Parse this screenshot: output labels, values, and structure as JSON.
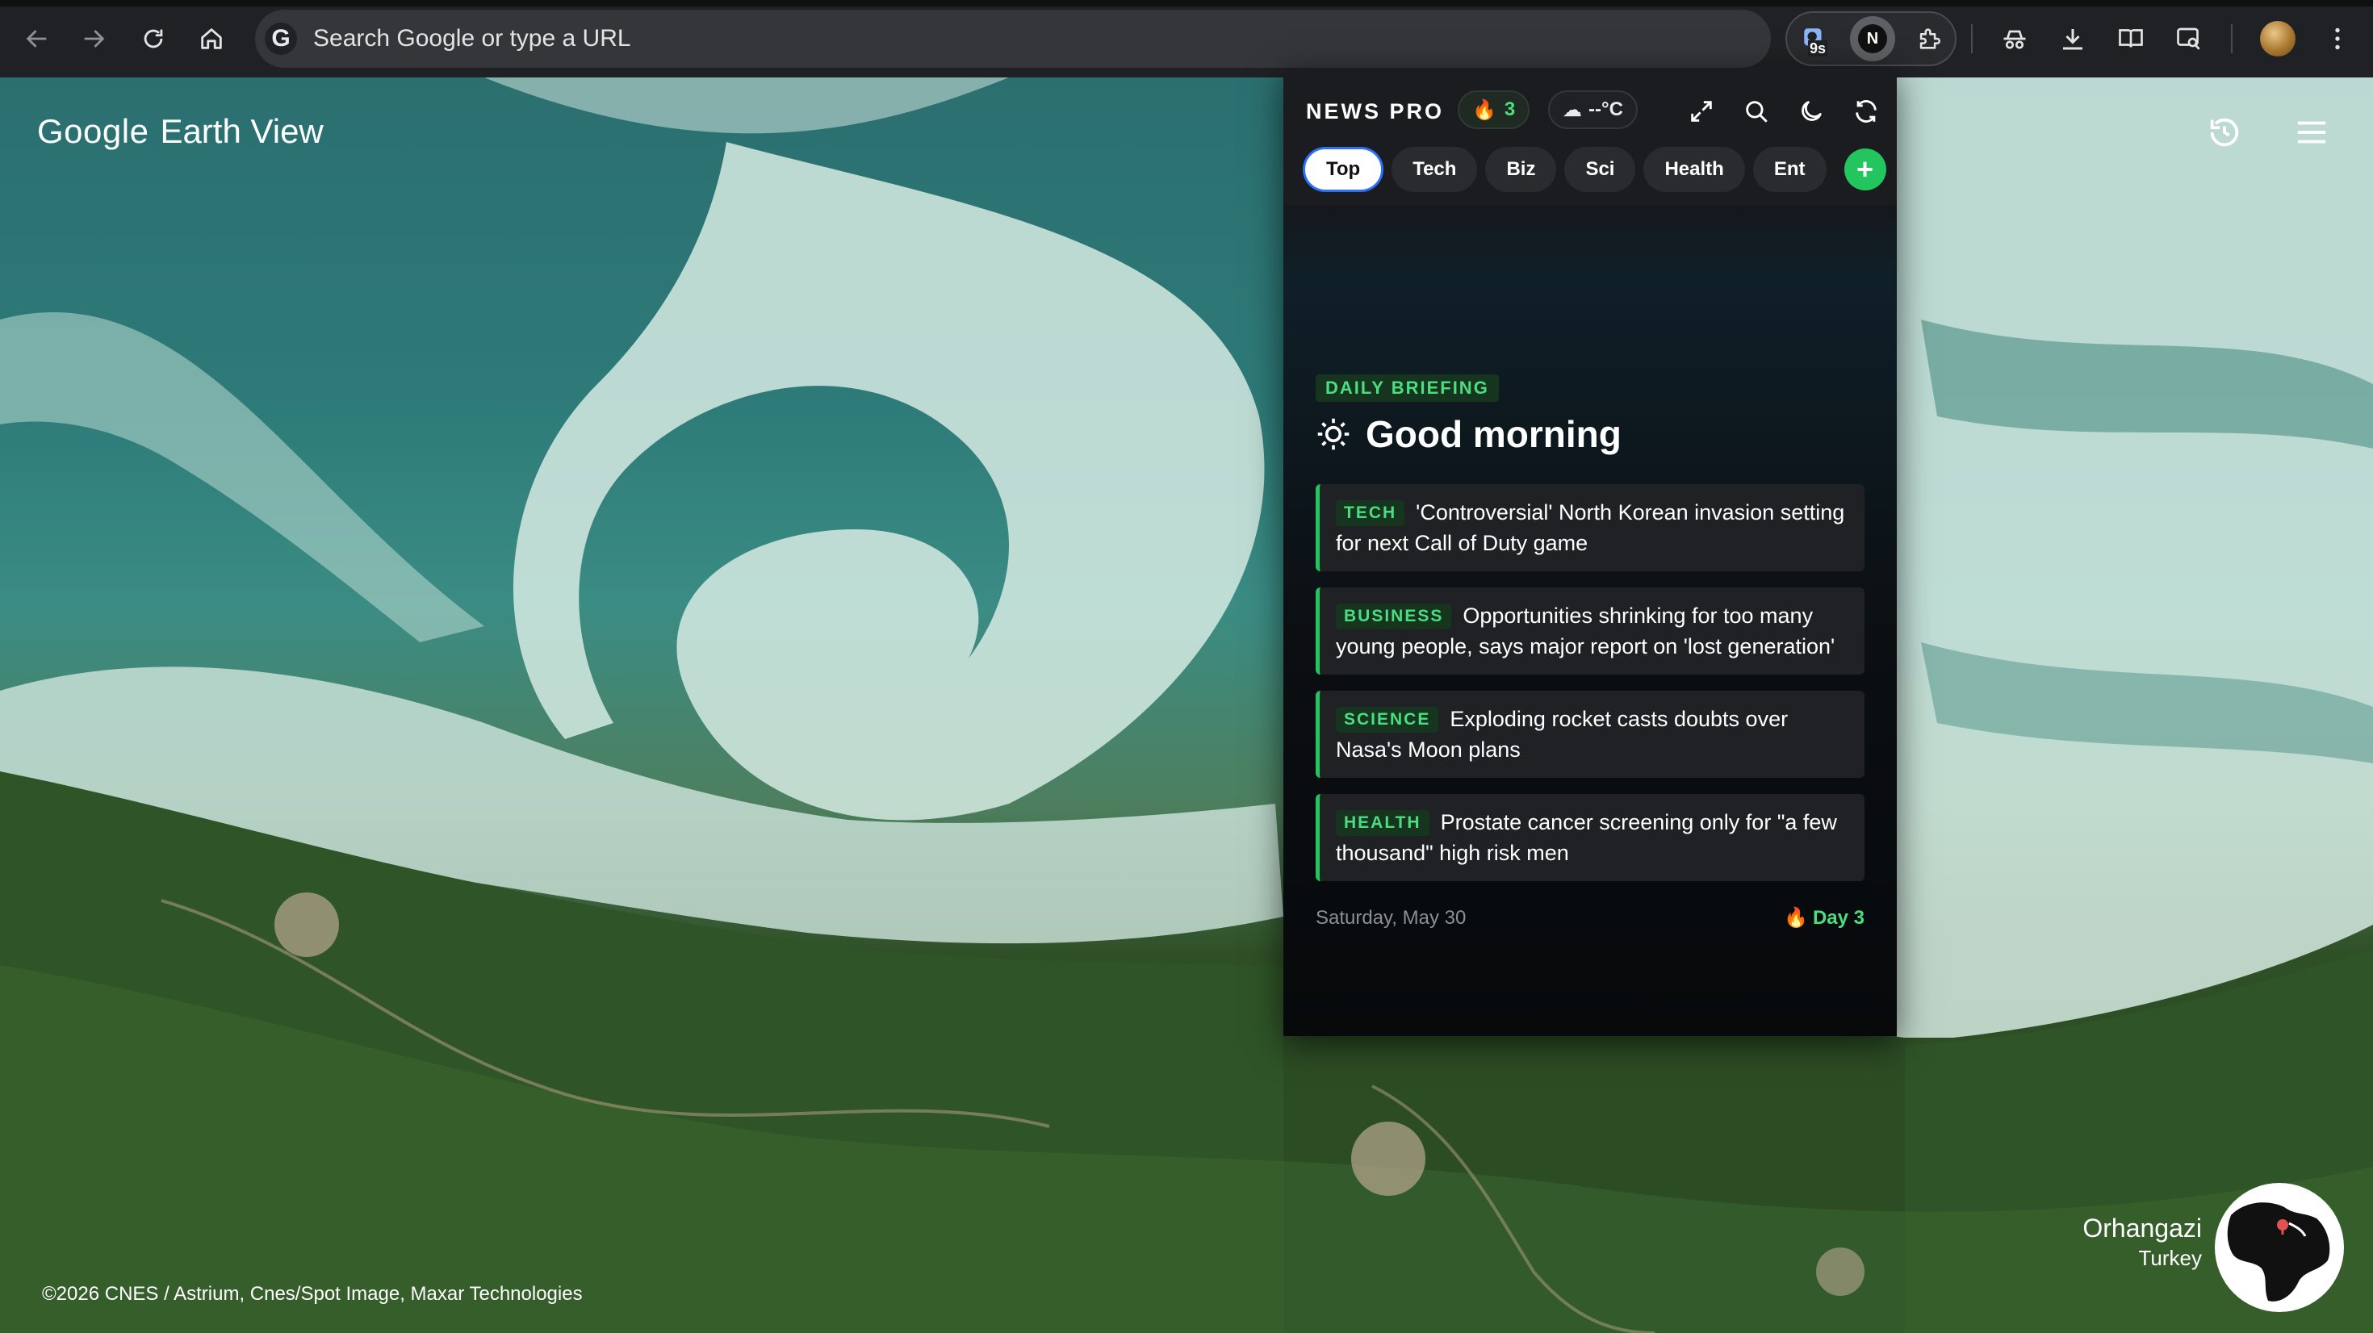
{
  "browser": {
    "omnibox_placeholder": "Search Google or type a URL",
    "google_logo_letter": "G",
    "extension_badge": "9s",
    "news_ext_letter": "N",
    "icons": [
      "back-arrow-icon",
      "forward-arrow-icon",
      "reload-icon",
      "home-icon",
      "extensions-puzzle-icon",
      "incognito-icon",
      "download-icon",
      "reading-list-icon",
      "tab-search-icon",
      "kebab-menu-icon"
    ]
  },
  "earth_view": {
    "logo_google": "Google",
    "logo_product": "Earth View",
    "location_name": "Orhangazi",
    "location_country": "Turkey",
    "credits": "©2026 CNES / Astrium, Cnes/Spot Image, Maxar Technologies",
    "colors": {
      "water": "#2c7a78",
      "foam": "#cfe6de",
      "land": "#2f4f26"
    }
  },
  "news_pro": {
    "brand": "NEWS PRO",
    "streak_count": "3",
    "weather": "--°C",
    "tabs": [
      {
        "label": "Top",
        "active": true
      },
      {
        "label": "Tech",
        "active": false
      },
      {
        "label": "Biz",
        "active": false
      },
      {
        "label": "Sci",
        "active": false
      },
      {
        "label": "Health",
        "active": false
      },
      {
        "label": "Ent",
        "active": false
      }
    ],
    "add_tab": "+",
    "briefing_label": "DAILY BRIEFING",
    "greeting": "Good morning",
    "stories": [
      {
        "category": "TECH",
        "headline": "'Controversial' North Korean invasion setting for next Call of Duty game"
      },
      {
        "category": "BUSINESS",
        "headline": "Opportunities shrinking for too many young people, says major report on 'lost generation'"
      },
      {
        "category": "SCIENCE",
        "headline": "Exploding rocket casts doubts over Nasa's Moon plans"
      },
      {
        "category": "HEALTH",
        "headline": "Prostate cancer screening only for \"a few thousand\" high risk men"
      }
    ],
    "date": "Saturday, May 30",
    "day_streak": "Day 3",
    "colors": {
      "accent": "#22c55e",
      "panel": "#0e1013",
      "card": "#1f2124",
      "active_tab_border": "#2b6fff"
    }
  }
}
